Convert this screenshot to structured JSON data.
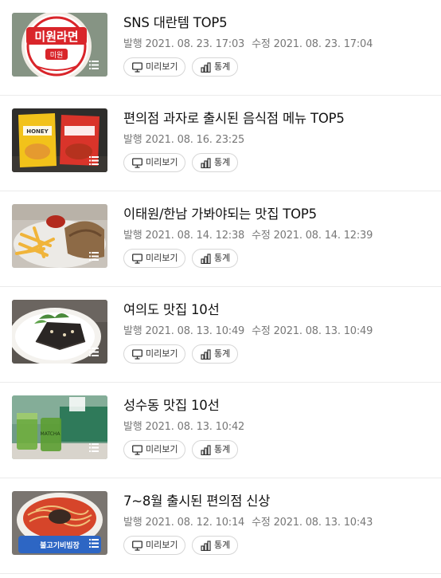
{
  "posts": [
    {
      "title": "SNS 대란템 TOP5",
      "published_label": "발행",
      "published": "2021. 08. 23. 17:03",
      "modified_label": "수정",
      "modified": "2021. 08. 23. 17:04",
      "preview_label": "미리보기",
      "stats_label": "통계",
      "thumb_text": "미원라면"
    },
    {
      "title": "편의점 과자로 출시된 음식점 메뉴 TOP5",
      "published_label": "발행",
      "published": "2021. 08. 16. 23:25",
      "modified_label": "",
      "modified": "",
      "preview_label": "미리보기",
      "stats_label": "통계",
      "thumb_text": "HONEY"
    },
    {
      "title": "이태원/한남 가봐야되는 맛집 TOP5",
      "published_label": "발행",
      "published": "2021. 08. 14. 12:38",
      "modified_label": "수정",
      "modified": "2021. 08. 14. 12:39",
      "preview_label": "미리보기",
      "stats_label": "통계",
      "thumb_text": ""
    },
    {
      "title": "여의도 맛집 10선",
      "published_label": "발행",
      "published": "2021. 08. 13. 10:49",
      "modified_label": "수정",
      "modified": "2021. 08. 13. 10:49",
      "preview_label": "미리보기",
      "stats_label": "통계",
      "thumb_text": ""
    },
    {
      "title": "성수동 맛집 10선",
      "published_label": "발행",
      "published": "2021. 08. 13. 10:42",
      "modified_label": "",
      "modified": "",
      "preview_label": "미리보기",
      "stats_label": "통계",
      "thumb_text": "MATCHA"
    },
    {
      "title": "7~8월 출시된 편의점 신상",
      "published_label": "발행",
      "published": "2021. 08. 12. 10:14",
      "modified_label": "수정",
      "modified": "2021. 08. 13. 10:43",
      "preview_label": "미리보기",
      "stats_label": "통계",
      "thumb_text": "불고기비빔장"
    }
  ]
}
